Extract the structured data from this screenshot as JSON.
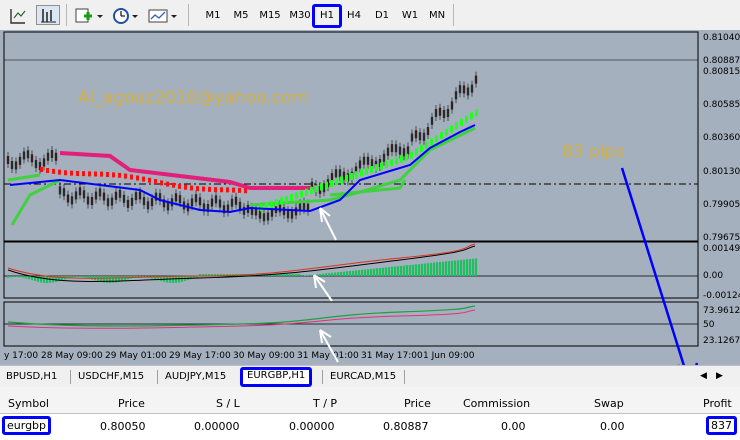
{
  "toolbar": {
    "icons": [
      "crosshair-icon",
      "line-tool-icon",
      "new-order-icon",
      "clock-icon",
      "template-icon"
    ],
    "timeframes": [
      "M1",
      "M5",
      "M15",
      "M30",
      "H1",
      "H4",
      "D1",
      "W1",
      "MN"
    ],
    "active_timeframe": "H1"
  },
  "chart": {
    "watermark": "Al_agouz2010@yahoo.com",
    "annotation": "83 pips",
    "price_axis": [
      "0.81040",
      "0.80887",
      "0.80815",
      "0.80585",
      "0.80360",
      "0.80130",
      "0.79905",
      "0.79675"
    ],
    "macd_axis": [
      "0.001492",
      "0.00",
      "-0.00124"
    ],
    "rsi_axis": [
      "73.9612",
      "50",
      "23.1267"
    ],
    "time_axis": [
      "y 17:00",
      "28 May 09:00",
      "29 May 01:00",
      "29 May 17:00",
      "30 May 09:00",
      "31 May 01:00",
      "31 May 17:00",
      "1 Jun 09:00"
    ],
    "colors": {
      "background": "#a4b0bd",
      "upper_band": "#e0207a",
      "lower_band": "#40d040",
      "red_dots": "#ff1010",
      "blue_line": "#0000ff",
      "arrow": "#ffffff",
      "annotation": "#d4b040"
    }
  },
  "tabs": [
    "BPUSD,H1",
    "USDCHF,M15",
    "AUDJPY,M15",
    "EURGBP,H1",
    "EURCAD,M15"
  ],
  "active_tab": "EURGBP,H1",
  "terminal": {
    "headers": [
      "Symbol",
      "Price",
      "S / L",
      "T / P",
      "Price",
      "Commission",
      "Swap",
      "Profit"
    ],
    "row": [
      "eurgbp",
      "0.80050",
      "0.00000",
      "0.00000",
      "0.80887",
      "0.00",
      "0.00",
      "837"
    ]
  }
}
